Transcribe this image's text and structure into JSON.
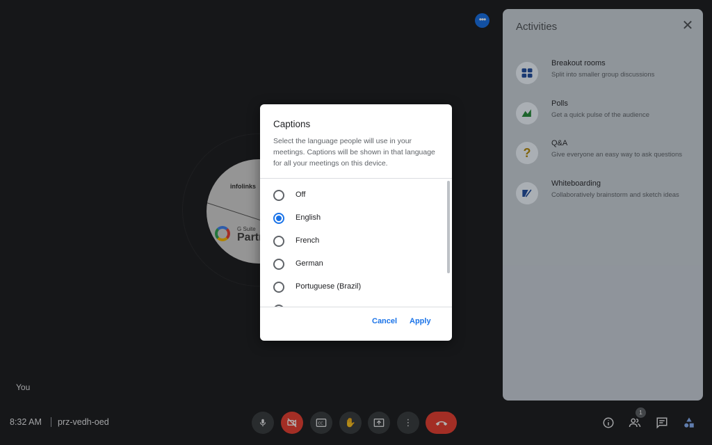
{
  "stage": {
    "participant_label": "You",
    "avatar_logo_text": "infolinks",
    "avatar_badge_small": "G Suite",
    "avatar_badge_big": "Partn"
  },
  "activities": {
    "title": "Activities",
    "items": [
      {
        "name": "Breakout rooms",
        "desc": "Split into smaller group discussions",
        "icon": "breakout-rooms-icon"
      },
      {
        "name": "Polls",
        "desc": "Get a quick pulse of the audience",
        "icon": "polls-icon"
      },
      {
        "name": "Q&A",
        "desc": "Give everyone an easy way to ask questions",
        "icon": "qa-icon"
      },
      {
        "name": "Whiteboarding",
        "desc": "Collaboratively brainstorm and sketch ideas",
        "icon": "whiteboard-icon"
      }
    ]
  },
  "dialog": {
    "title": "Captions",
    "description": "Select the language people will use in your meetings. Captions will be shown in that language for all your meetings on this device.",
    "options": [
      "Off",
      "English",
      "French",
      "German",
      "Portuguese (Brazil)"
    ],
    "selected": "English",
    "cancel_label": "Cancel",
    "apply_label": "Apply"
  },
  "bottom_bar": {
    "time": "8:32 AM",
    "meeting_code": "prz-vedh-oed",
    "people_count": "1"
  },
  "colors": {
    "accent": "#1a73e8",
    "danger": "#ea4335",
    "background": "#202124"
  }
}
